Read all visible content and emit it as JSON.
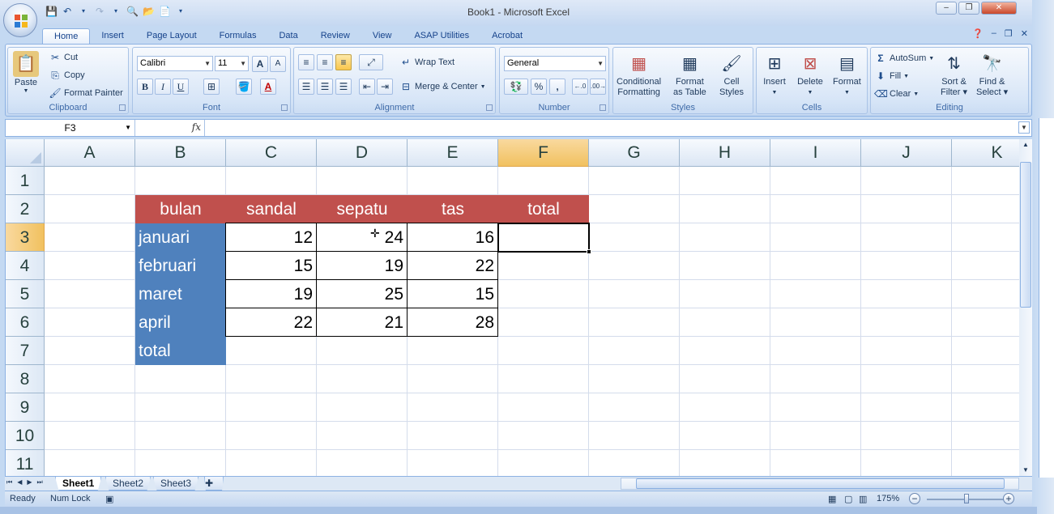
{
  "window": {
    "title": "Book1 - Microsoft Excel",
    "minimize": "–",
    "restore": "❐",
    "close": "✕"
  },
  "qat": {
    "save_icon": "save-icon",
    "undo_icon": "undo-icon",
    "redo_icon": "redo-icon"
  },
  "tabs": [
    "Home",
    "Insert",
    "Page Layout",
    "Formulas",
    "Data",
    "Review",
    "View",
    "ASAP Utilities",
    "Acrobat"
  ],
  "ribbon": {
    "clipboard": {
      "label": "Clipboard",
      "paste": "Paste",
      "cut": "Cut",
      "copy": "Copy",
      "format_painter": "Format Painter"
    },
    "font": {
      "label": "Font",
      "name": "Calibri",
      "size": "11",
      "bold": "B",
      "italic": "I",
      "underline": "U",
      "grow": "A",
      "shrink": "A",
      "font_color": "A"
    },
    "alignment": {
      "label": "Alignment",
      "wrap": "Wrap Text",
      "merge": "Merge & Center"
    },
    "number": {
      "label": "Number",
      "format": "General",
      "percent": "%",
      "comma": ","
    },
    "styles": {
      "label": "Styles",
      "conditional_1": "Conditional",
      "conditional_2": "Formatting",
      "format_table_1": "Format",
      "format_table_2": "as Table",
      "cell_styles_1": "Cell",
      "cell_styles_2": "Styles"
    },
    "cells": {
      "label": "Cells",
      "insert": "Insert",
      "delete": "Delete",
      "format": "Format"
    },
    "editing": {
      "label": "Editing",
      "autosum": "AutoSum",
      "fill": "Fill",
      "clear": "Clear",
      "sort_1": "Sort &",
      "sort_2": "Filter",
      "find_1": "Find &",
      "find_2": "Select"
    }
  },
  "formula_bar": {
    "name_box": "F3",
    "fx": "fx",
    "value": ""
  },
  "columns": [
    "A",
    "B",
    "C",
    "D",
    "E",
    "F",
    "G",
    "H",
    "I",
    "J",
    "K"
  ],
  "selected_column": "F",
  "rows": [
    "1",
    "2",
    "3",
    "4",
    "5",
    "6",
    "7",
    "8",
    "9",
    "10",
    "11"
  ],
  "selected_row": "3",
  "table": {
    "headers": [
      "bulan",
      "sandal",
      "sepatu",
      "tas",
      "total"
    ],
    "labels": [
      "januari",
      "februari",
      "maret",
      "april",
      "total"
    ],
    "values": [
      [
        "12",
        "24",
        "16"
      ],
      [
        "15",
        "19",
        "22"
      ],
      [
        "19",
        "25",
        "15"
      ],
      [
        "22",
        "21",
        "28"
      ]
    ]
  },
  "colors": {
    "header_fill": "#c0504d",
    "label_fill": "#4f81bd",
    "selection": "#f1c15f"
  },
  "sheets": [
    "Sheet1",
    "Sheet2",
    "Sheet3"
  ],
  "active_sheet": "Sheet1",
  "status": {
    "ready": "Ready",
    "numlock": "Num Lock",
    "zoom": "175%"
  }
}
